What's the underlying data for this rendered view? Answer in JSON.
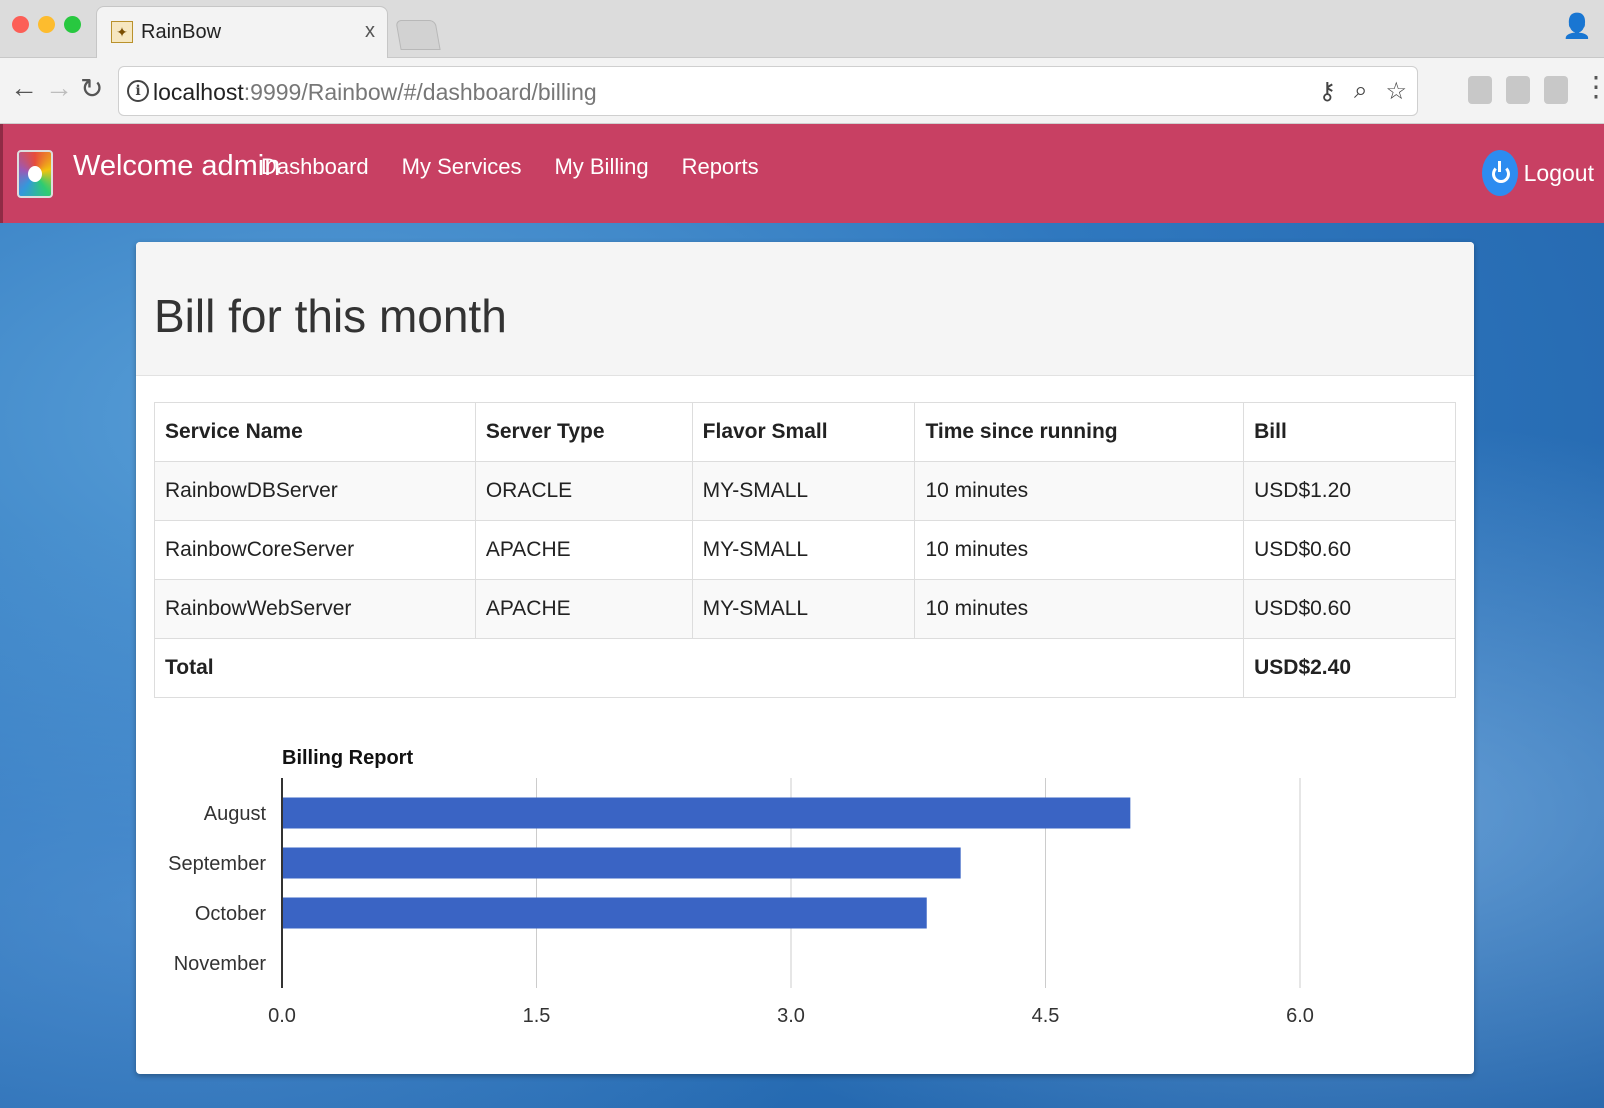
{
  "browser": {
    "tab_title": "RainBow",
    "tab_close": "x",
    "url_host": "localhost",
    "url_rest": ":9999/Rainbow/#/dashboard/billing"
  },
  "navbar": {
    "welcome": "Welcome admin",
    "links": [
      "Dashboard",
      "My Services",
      "My Billing",
      "Reports"
    ],
    "logout": "Logout"
  },
  "card": {
    "title": "Bill for this month"
  },
  "table": {
    "headers": [
      "Service Name",
      "Server Type",
      "Flavor Small",
      "Time since running",
      "Bill"
    ],
    "rows": [
      [
        "RainbowDBServer",
        "ORACLE",
        "MY-SMALL",
        "10 minutes",
        "USD$1.20"
      ],
      [
        "RainbowCoreServer",
        "APACHE",
        "MY-SMALL",
        "10 minutes",
        "USD$0.60"
      ],
      [
        "RainbowWebServer",
        "APACHE",
        "MY-SMALL",
        "10 minutes",
        "USD$0.60"
      ]
    ],
    "total_label": "Total",
    "total_value": "USD$2.40"
  },
  "colors": {
    "navbar": "#c84063",
    "bar": "#3a64c4",
    "logout_icon": "#2d8cf0"
  },
  "chart_data": {
    "type": "bar",
    "orientation": "horizontal",
    "title": "Billing Report",
    "categories": [
      "August",
      "September",
      "October",
      "November"
    ],
    "values": [
      5.0,
      4.0,
      3.8,
      0
    ],
    "xlim": [
      0,
      6
    ],
    "xticks": [
      "0.0",
      "1.5",
      "3.0",
      "4.5",
      "6.0"
    ],
    "grid": true
  }
}
